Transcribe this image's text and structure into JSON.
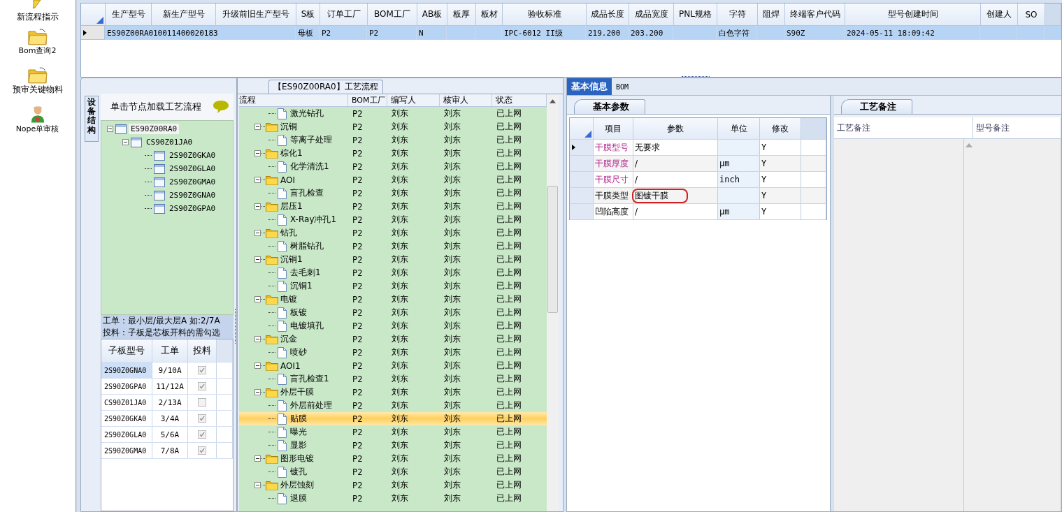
{
  "nav": [
    {
      "label": "新流程指示",
      "kind": "pencil"
    },
    {
      "label": "Bom查询2",
      "kind": "folder"
    },
    {
      "label": "预审关键物料",
      "kind": "folder"
    },
    {
      "label": "Nope单审核",
      "kind": "person"
    }
  ],
  "model_table": {
    "columns": [
      "生产型号",
      "新生产型号",
      "升级前旧生产型号",
      "S板",
      "订单工厂",
      "BOM工厂",
      "AB板",
      "板厚",
      "板材",
      "验收标准",
      "成品长度",
      "成品宽度",
      "PNL规格",
      "字符",
      "阻焊",
      "终端客户代码",
      "型号创建时间",
      "创建人",
      "SO"
    ],
    "rows": [
      {
        "selected": true,
        "cells": [
          "ES90Z00RA0",
          "10011400020183",
          null,
          "母板",
          "P2",
          "P2",
          "N",
          null,
          null,
          "IPC-6012 II级",
          "219.200",
          "203.200",
          null,
          "白色字符",
          null,
          "S90Z",
          "2024-05-11 18:09:42",
          null,
          null
        ]
      }
    ]
  },
  "structure_panel": {
    "side_tab": "设备结构",
    "hint": "单击节点加载工艺流程",
    "tree": [
      {
        "label": "ES90Z00RA0",
        "selected": true,
        "expanded": true,
        "children": [
          {
            "label": "CS90Z01JA0",
            "selected": false,
            "expanded": true,
            "children": [
              {
                "label": "2S90Z0GKA0",
                "selected": false
              },
              {
                "label": "2S90Z0GLA0",
                "selected": false
              },
              {
                "label": "2S90Z0GMA0",
                "selected": false
              },
              {
                "label": "2S90Z0GNA0",
                "selected": false
              },
              {
                "label": "2S90Z0GPA0",
                "selected": false
              }
            ]
          }
        ]
      }
    ],
    "notes": [
      "工单：最小层/最大层A 如:2/7A",
      "投料：子板是芯板开料的需勾选"
    ],
    "board_table": {
      "columns": [
        "子板型号",
        "工单",
        "投料"
      ],
      "rows": [
        {
          "model": "2S90Z0GNA0",
          "order": "9/10A",
          "checked": true,
          "selected": true
        },
        {
          "model": "2S90Z0GPA0",
          "order": "11/12A",
          "checked": true,
          "selected": false
        },
        {
          "model": "CS90Z01JA0",
          "order": "2/13A",
          "checked": false,
          "selected": false
        },
        {
          "model": "2S90Z0GKA0",
          "order": "3/4A",
          "checked": true,
          "selected": false
        },
        {
          "model": "2S90Z0GLA0",
          "order": "5/6A",
          "checked": true,
          "selected": false
        },
        {
          "model": "2S90Z0GMA0",
          "order": "7/8A",
          "checked": true,
          "selected": false
        }
      ]
    }
  },
  "process": {
    "title": "【ES90Z00RA0】工艺流程",
    "columns": [
      "流程",
      "BOM工厂",
      "编写人",
      "核审人",
      "状态"
    ],
    "rows": [
      {
        "kind": "step",
        "name": "激光钻孔",
        "factory": "P2",
        "writer": "刘东",
        "reviewer": "刘东",
        "status": "已上网",
        "selected": false
      },
      {
        "kind": "folder",
        "name": "沉铜",
        "factory": "P2",
        "writer": "刘东",
        "reviewer": "刘东",
        "status": "已上网",
        "selected": false,
        "expanded": true,
        "children": [
          {
            "kind": "step",
            "name": "等离子处理",
            "factory": "P2",
            "writer": "刘东",
            "reviewer": "刘东",
            "status": "已上网",
            "selected": false
          }
        ]
      },
      {
        "kind": "folder",
        "name": "棕化1",
        "factory": "P2",
        "writer": "刘东",
        "reviewer": "刘东",
        "status": "已上网",
        "selected": false,
        "expanded": true,
        "children": [
          {
            "kind": "step",
            "name": "化学清洗1",
            "factory": "P2",
            "writer": "刘东",
            "reviewer": "刘东",
            "status": "已上网",
            "selected": false
          }
        ]
      },
      {
        "kind": "folder",
        "name": "AOI",
        "factory": "P2",
        "writer": "刘东",
        "reviewer": "刘东",
        "status": "已上网",
        "selected": false,
        "expanded": true,
        "children": [
          {
            "kind": "step",
            "name": "盲孔检查",
            "factory": "P2",
            "writer": "刘东",
            "reviewer": "刘东",
            "status": "已上网",
            "selected": false
          }
        ]
      },
      {
        "kind": "folder",
        "name": "层压1",
        "factory": "P2",
        "writer": "刘东",
        "reviewer": "刘东",
        "status": "已上网",
        "selected": false,
        "expanded": true,
        "children": [
          {
            "kind": "step",
            "name": "X-Ray冲孔1",
            "factory": "P2",
            "writer": "刘东",
            "reviewer": "刘东",
            "status": "已上网",
            "selected": false
          }
        ]
      },
      {
        "kind": "folder",
        "name": "钻孔",
        "factory": "P2",
        "writer": "刘东",
        "reviewer": "刘东",
        "status": "已上网",
        "selected": false,
        "expanded": true,
        "children": [
          {
            "kind": "step",
            "name": "树脂钻孔",
            "factory": "P2",
            "writer": "刘东",
            "reviewer": "刘东",
            "status": "已上网",
            "selected": false
          }
        ]
      },
      {
        "kind": "folder",
        "name": "沉铜1",
        "factory": "P2",
        "writer": "刘东",
        "reviewer": "刘东",
        "status": "已上网",
        "selected": false,
        "expanded": true,
        "children": [
          {
            "kind": "step",
            "name": "去毛刺1",
            "factory": "P2",
            "writer": "刘东",
            "reviewer": "刘东",
            "status": "已上网",
            "selected": false
          },
          {
            "kind": "step",
            "name": "沉铜1",
            "factory": "P2",
            "writer": "刘东",
            "reviewer": "刘东",
            "status": "已上网",
            "selected": false
          }
        ]
      },
      {
        "kind": "folder",
        "name": "电镀",
        "factory": "P2",
        "writer": "刘东",
        "reviewer": "刘东",
        "status": "已上网",
        "selected": false,
        "expanded": true,
        "children": [
          {
            "kind": "step",
            "name": "板镀",
            "factory": "P2",
            "writer": "刘东",
            "reviewer": "刘东",
            "status": "已上网",
            "selected": false
          },
          {
            "kind": "step",
            "name": "电镀填孔",
            "factory": "P2",
            "writer": "刘东",
            "reviewer": "刘东",
            "status": "已上网",
            "selected": false
          }
        ]
      },
      {
        "kind": "folder",
        "name": "沉金",
        "factory": "P2",
        "writer": "刘东",
        "reviewer": "刘东",
        "status": "已上网",
        "selected": false,
        "expanded": true,
        "children": [
          {
            "kind": "step",
            "name": "喷砂",
            "factory": "P2",
            "writer": "刘东",
            "reviewer": "刘东",
            "status": "已上网",
            "selected": false
          }
        ]
      },
      {
        "kind": "folder",
        "name": "AOI1",
        "factory": "P2",
        "writer": "刘东",
        "reviewer": "刘东",
        "status": "已上网",
        "selected": false,
        "expanded": true,
        "children": [
          {
            "kind": "step",
            "name": "盲孔检查1",
            "factory": "P2",
            "writer": "刘东",
            "reviewer": "刘东",
            "status": "已上网",
            "selected": false
          }
        ]
      },
      {
        "kind": "folder",
        "name": "外层干膜",
        "factory": "P2",
        "writer": "刘东",
        "reviewer": "刘东",
        "status": "已上网",
        "selected": false,
        "expanded": true,
        "children": [
          {
            "kind": "step",
            "name": "外层前处理",
            "factory": "P2",
            "writer": "刘东",
            "reviewer": "刘东",
            "status": "已上网",
            "selected": false
          },
          {
            "kind": "step",
            "name": "贴膜",
            "factory": "P2",
            "writer": "刘东",
            "reviewer": "刘东",
            "status": "已上网",
            "selected": true
          },
          {
            "kind": "step",
            "name": "曝光",
            "factory": "P2",
            "writer": "刘东",
            "reviewer": "刘东",
            "status": "已上网",
            "selected": false
          },
          {
            "kind": "step",
            "name": "显影",
            "factory": "P2",
            "writer": "刘东",
            "reviewer": "刘东",
            "status": "已上网",
            "selected": false
          }
        ]
      },
      {
        "kind": "folder",
        "name": "图形电镀",
        "factory": "P2",
        "writer": "刘东",
        "reviewer": "刘东",
        "status": "已上网",
        "selected": false,
        "expanded": true,
        "children": [
          {
            "kind": "step",
            "name": "镀孔",
            "factory": "P2",
            "writer": "刘东",
            "reviewer": "刘东",
            "status": "已上网",
            "selected": false
          }
        ]
      },
      {
        "kind": "folder",
        "name": "外层蚀刻",
        "factory": "P2",
        "writer": "刘东",
        "reviewer": "刘东",
        "status": "已上网",
        "selected": false,
        "expanded": true,
        "children": [
          {
            "kind": "step",
            "name": "退膜",
            "factory": "P2",
            "writer": "刘东",
            "reviewer": "刘东",
            "status": "已上网",
            "selected": false
          }
        ]
      }
    ]
  },
  "detail": {
    "tabs": [
      {
        "label": "基本信息",
        "selected": true
      },
      {
        "label": "BOM",
        "selected": false
      }
    ],
    "params_tab": "基本参数",
    "params_columns": [
      "项目",
      "参数",
      "单位",
      "修改"
    ],
    "params": [
      {
        "item": "干膜型号",
        "value": "无要求",
        "modify": "Y",
        "required": true,
        "current": true,
        "circled": false
      },
      {
        "item": "干膜厚度",
        "value": "/",
        "unit": "μm",
        "modify": "Y",
        "required": true,
        "current": false,
        "circled": false
      },
      {
        "item": "干膜尺寸",
        "value": "/",
        "unit": "inch",
        "modify": "Y",
        "required": true,
        "current": false,
        "circled": false
      },
      {
        "item": "干膜类型",
        "value": "图镀干膜",
        "modify": "Y",
        "required": false,
        "current": false,
        "circled": true
      },
      {
        "item": "凹陷高度",
        "value": "/",
        "unit": "μm",
        "modify": "Y",
        "required": false,
        "current": false,
        "circled": false
      }
    ],
    "notes_tab": "工艺备注",
    "notes_columns": [
      "工艺备注",
      "型号备注"
    ]
  }
}
